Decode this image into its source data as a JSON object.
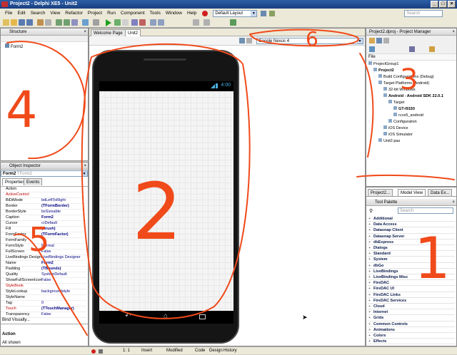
{
  "window": {
    "title": "Project2 - Delphi XE5 - Unit2"
  },
  "menu": [
    "File",
    "Edit",
    "Search",
    "View",
    "Refactor",
    "Project",
    "Run",
    "Component",
    "Tools",
    "Window",
    "Help"
  ],
  "toolbar": {
    "layout_select": "Default Layout",
    "search_placeholder": "Search"
  },
  "structure": {
    "title": "Structure",
    "root": "Form2"
  },
  "editor": {
    "tabs": [
      "Welcome Page",
      "Unit2"
    ],
    "device_select": "Google Nexus 4",
    "status_time": "4:00"
  },
  "object_inspector": {
    "title": "Object Inspector",
    "selected": "Form2",
    "selected_type": "TForm2",
    "tabs": [
      "Properties",
      "Events"
    ],
    "rows": [
      {
        "k": "Action",
        "v": ""
      },
      {
        "k": "ActiveControl",
        "v": ""
      },
      {
        "k": "BiDiMode",
        "v": "bdLeftToRight"
      },
      {
        "k": "Border",
        "v": "(TFormBorder)"
      },
      {
        "k": "BorderStyle",
        "v": "bsSizeable"
      },
      {
        "k": "Caption",
        "v": "Form2"
      },
      {
        "k": "Cursor",
        "v": "crDefault"
      },
      {
        "k": "Fill",
        "v": "(Brush)"
      },
      {
        "k": "FormFactor",
        "v": "(TFormFactor)"
      },
      {
        "k": "FormFamily",
        "v": ""
      },
      {
        "k": "FormStyle",
        "v": "Normal"
      },
      {
        "k": "FullScreen",
        "v": "False"
      },
      {
        "k": "LiveBindings Designer",
        "v": "LiveBindings Designer"
      },
      {
        "k": "Name",
        "v": "Form2"
      },
      {
        "k": "Padding",
        "v": "(TBounds)"
      },
      {
        "k": "Quality",
        "v": "SystemDefault"
      },
      {
        "k": "ShowFullScreenIcon",
        "v": "False"
      },
      {
        "k": "StyleBook",
        "v": ""
      },
      {
        "k": "StyleLookup",
        "v": "backgroundstyle"
      },
      {
        "k": "StyleName",
        "v": ""
      },
      {
        "k": "Tag",
        "v": "0"
      },
      {
        "k": "Touch",
        "v": "(TTouchManager)"
      },
      {
        "k": "Transparency",
        "v": "False"
      }
    ],
    "bind_visually": "Bind Visually...",
    "footer_label": "Action",
    "footer_status": "All shown"
  },
  "project_manager": {
    "title": "Project2.dproj - Project Manager",
    "file_label": "File",
    "items": [
      {
        "label": "ProjectGroup1",
        "indent": 0,
        "bold": false
      },
      {
        "label": "Project2",
        "indent": 1,
        "bold": true
      },
      {
        "label": "Build Configurations (Debug)",
        "indent": 2,
        "bold": false
      },
      {
        "label": "Target Platforms (Android)",
        "indent": 2,
        "bold": false
      },
      {
        "label": "32-bit Windows",
        "indent": 3,
        "bold": false
      },
      {
        "label": "Android - Android SDK 22.0.1",
        "indent": 3,
        "bold": true
      },
      {
        "label": "Target",
        "indent": 4,
        "bold": false
      },
      {
        "label": "GT-I9150",
        "indent": 5,
        "bold": true
      },
      {
        "label": "rcce5_android",
        "indent": 5,
        "bold": false
      },
      {
        "label": "Configuration",
        "indent": 4,
        "bold": false
      },
      {
        "label": "iOS Device",
        "indent": 3,
        "bold": false
      },
      {
        "label": "iOS Simulator",
        "indent": 3,
        "bold": false
      },
      {
        "label": "Unit2.pas",
        "indent": 2,
        "bold": false
      }
    ]
  },
  "palette": {
    "tabs": [
      "Project2...",
      "Model View",
      "Data Ex..."
    ],
    "title": "Tool Palette",
    "search_placeholder": "Search",
    "categories": [
      "Additional",
      "Data Access",
      "Datasnap Client",
      "Datasnap Server",
      "dbExpress",
      "Dialogs",
      "Standard",
      "System",
      "dbGo",
      "LiveBindings",
      "LiveBindings Misc",
      "FireDAC",
      "FireDAC UI",
      "FireDAC Links",
      "FireDAC Services",
      "Cloud",
      "Internet",
      "Grids",
      "Common Controls",
      "Animations",
      "Colors",
      "Effects"
    ]
  },
  "statusbar": {
    "position": "1: 1",
    "mode": "Insert",
    "state": "Modified",
    "tabs": [
      "Code",
      "Design",
      "History"
    ]
  },
  "annotations": [
    "4",
    "2",
    "6",
    "3",
    "1",
    "5"
  ]
}
